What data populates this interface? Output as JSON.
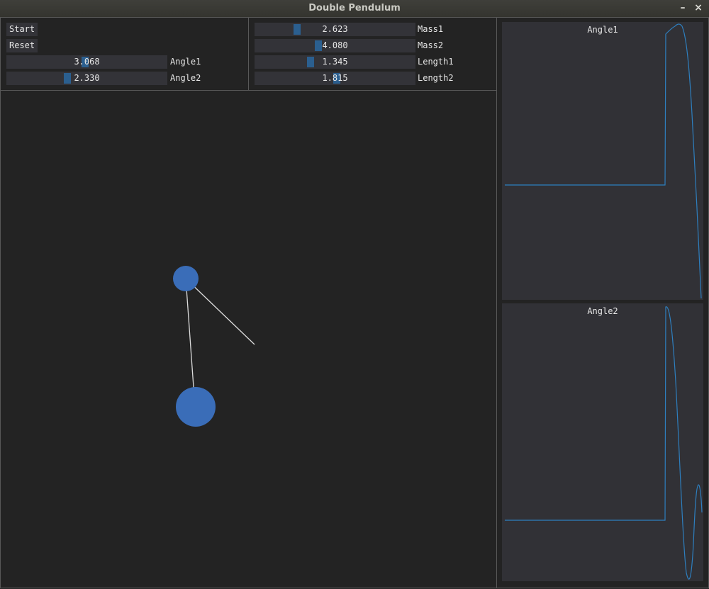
{
  "window": {
    "title": "Double Pendulum",
    "minimize_glyph": "–",
    "close_glyph": "×"
  },
  "controls": {
    "start_label": "Start",
    "reset_label": "Reset",
    "angle1": {
      "label": "Angle1",
      "value": "3.068",
      "fraction": 0.49
    },
    "angle2": {
      "label": "Angle2",
      "value": "2.330",
      "fraction": 0.37
    },
    "mass1": {
      "label": "Mass1",
      "value": "2.623",
      "fraction": 0.25
    },
    "mass2": {
      "label": "Mass2",
      "value": "4.080",
      "fraction": 0.39
    },
    "length1": {
      "label": "Length1",
      "value": "1.345",
      "fraction": 0.34
    },
    "length2": {
      "label": "Length2",
      "value": "1.815",
      "fraction": 0.51
    }
  },
  "plots": {
    "angle1_title": "Angle1",
    "angle2_title": "Angle2"
  },
  "colors": {
    "accent": "#2b5f8f",
    "bob": "#3a6db8",
    "rod": "#dcdcdc",
    "plot_line": "#2e7fbf"
  }
}
